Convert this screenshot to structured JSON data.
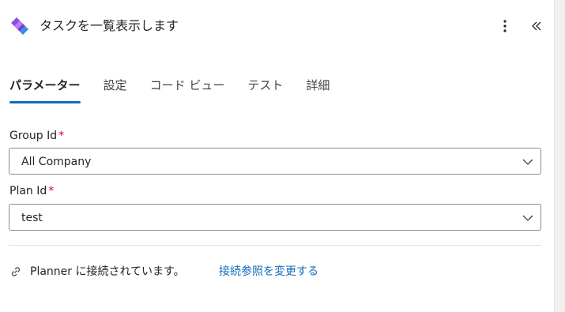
{
  "header": {
    "title": "タスクを一覧表示します",
    "logo_icon": "power-automate-logo-icon",
    "more_icon": "more-vertical-icon",
    "collapse_icon": "double-chevron-left-icon"
  },
  "tabs": [
    {
      "label": "パラメーター",
      "active": true
    },
    {
      "label": "設定",
      "active": false
    },
    {
      "label": "コード ビュー",
      "active": false
    },
    {
      "label": "テスト",
      "active": false
    },
    {
      "label": "詳細",
      "active": false
    }
  ],
  "fields": {
    "group": {
      "label": "Group Id",
      "required_mark": "*",
      "value": "All Company"
    },
    "plan": {
      "label": "Plan Id",
      "required_mark": "*",
      "value": "test"
    }
  },
  "connection": {
    "icon": "link-icon",
    "text": "Planner に接続されています。",
    "change_link": "接続参照を変更する"
  },
  "colors": {
    "accent": "#0f6cbd",
    "required": "#c50f1f",
    "logo_primary": "#7b3fe4",
    "logo_secondary": "#2f8de8"
  }
}
